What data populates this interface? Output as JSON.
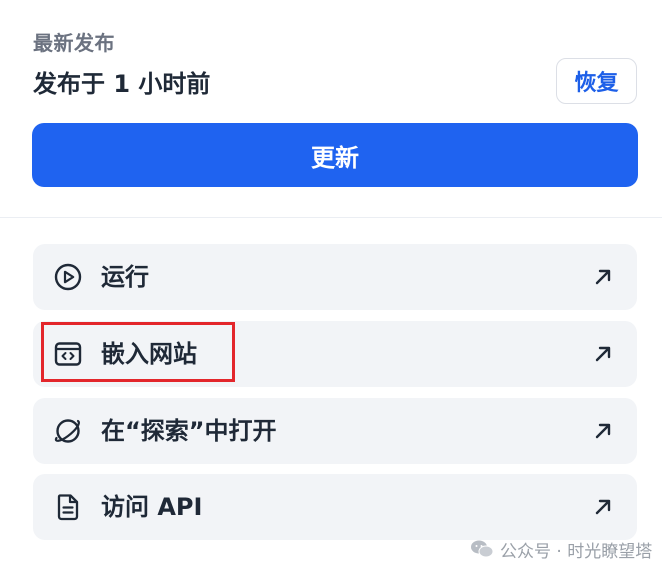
{
  "release": {
    "section_label": "最新发布",
    "published_text": "发布于 1 小时前",
    "restore_label": "恢复",
    "update_label": "更新"
  },
  "menu": {
    "items": [
      {
        "label": "运行",
        "icon": "play-circle-icon"
      },
      {
        "label": "嵌入网站",
        "icon": "embed-code-icon"
      },
      {
        "label": "在“探索”中打开",
        "icon": "explore-planet-icon"
      },
      {
        "label": "访问 API",
        "icon": "document-icon"
      }
    ]
  },
  "watermark": {
    "text": "公众号 · 时光瞭望塔"
  },
  "colors": {
    "primary": "#1f63f0",
    "highlight": "#e3262b",
    "item_bg": "#f2f4f7"
  }
}
